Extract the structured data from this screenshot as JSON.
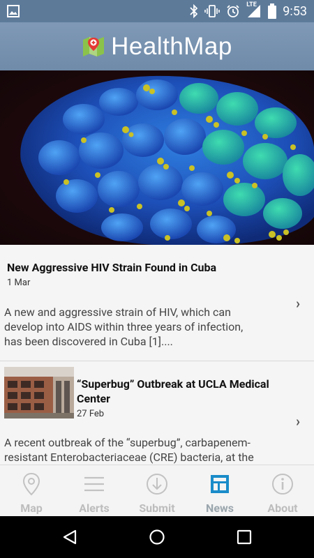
{
  "status_bar": {
    "time": "9:53",
    "network": "LTE"
  },
  "app": {
    "title": "HealthMap"
  },
  "feed": {
    "articles": [
      {
        "title": "New Aggressive HIV Strain Found in Cuba",
        "date": "1 Mar",
        "summary_lines": [
          "A new and aggressive strain of HIV, which can",
          "develop into AIDS within three years of infection,",
          "has been discovered in Cuba [1]...."
        ]
      },
      {
        "title_lines": [
          "“Superbug” Outbreak at UCLA Medical",
          "Center"
        ],
        "date": "27 Feb",
        "summary_lines": [
          "A recent outbreak of the “superbug”, carbapenem-",
          "resistant Enterobacteriaceae (CRE) bacteria, at the"
        ]
      }
    ]
  },
  "bottom_nav": {
    "items": [
      {
        "label": "Map",
        "icon": "map-pin-icon"
      },
      {
        "label": "Alerts",
        "icon": "menu-lines-icon"
      },
      {
        "label": "Submit",
        "icon": "download-circle-icon"
      },
      {
        "label": "News",
        "icon": "news-icon",
        "active": true
      },
      {
        "label": "About",
        "icon": "info-icon"
      }
    ]
  },
  "colors": {
    "status_bar": "#5d7a99",
    "app_bar": "#7591ae",
    "active_tab": "#1a8cc9",
    "inactive_tab": "#bdbdbd"
  }
}
